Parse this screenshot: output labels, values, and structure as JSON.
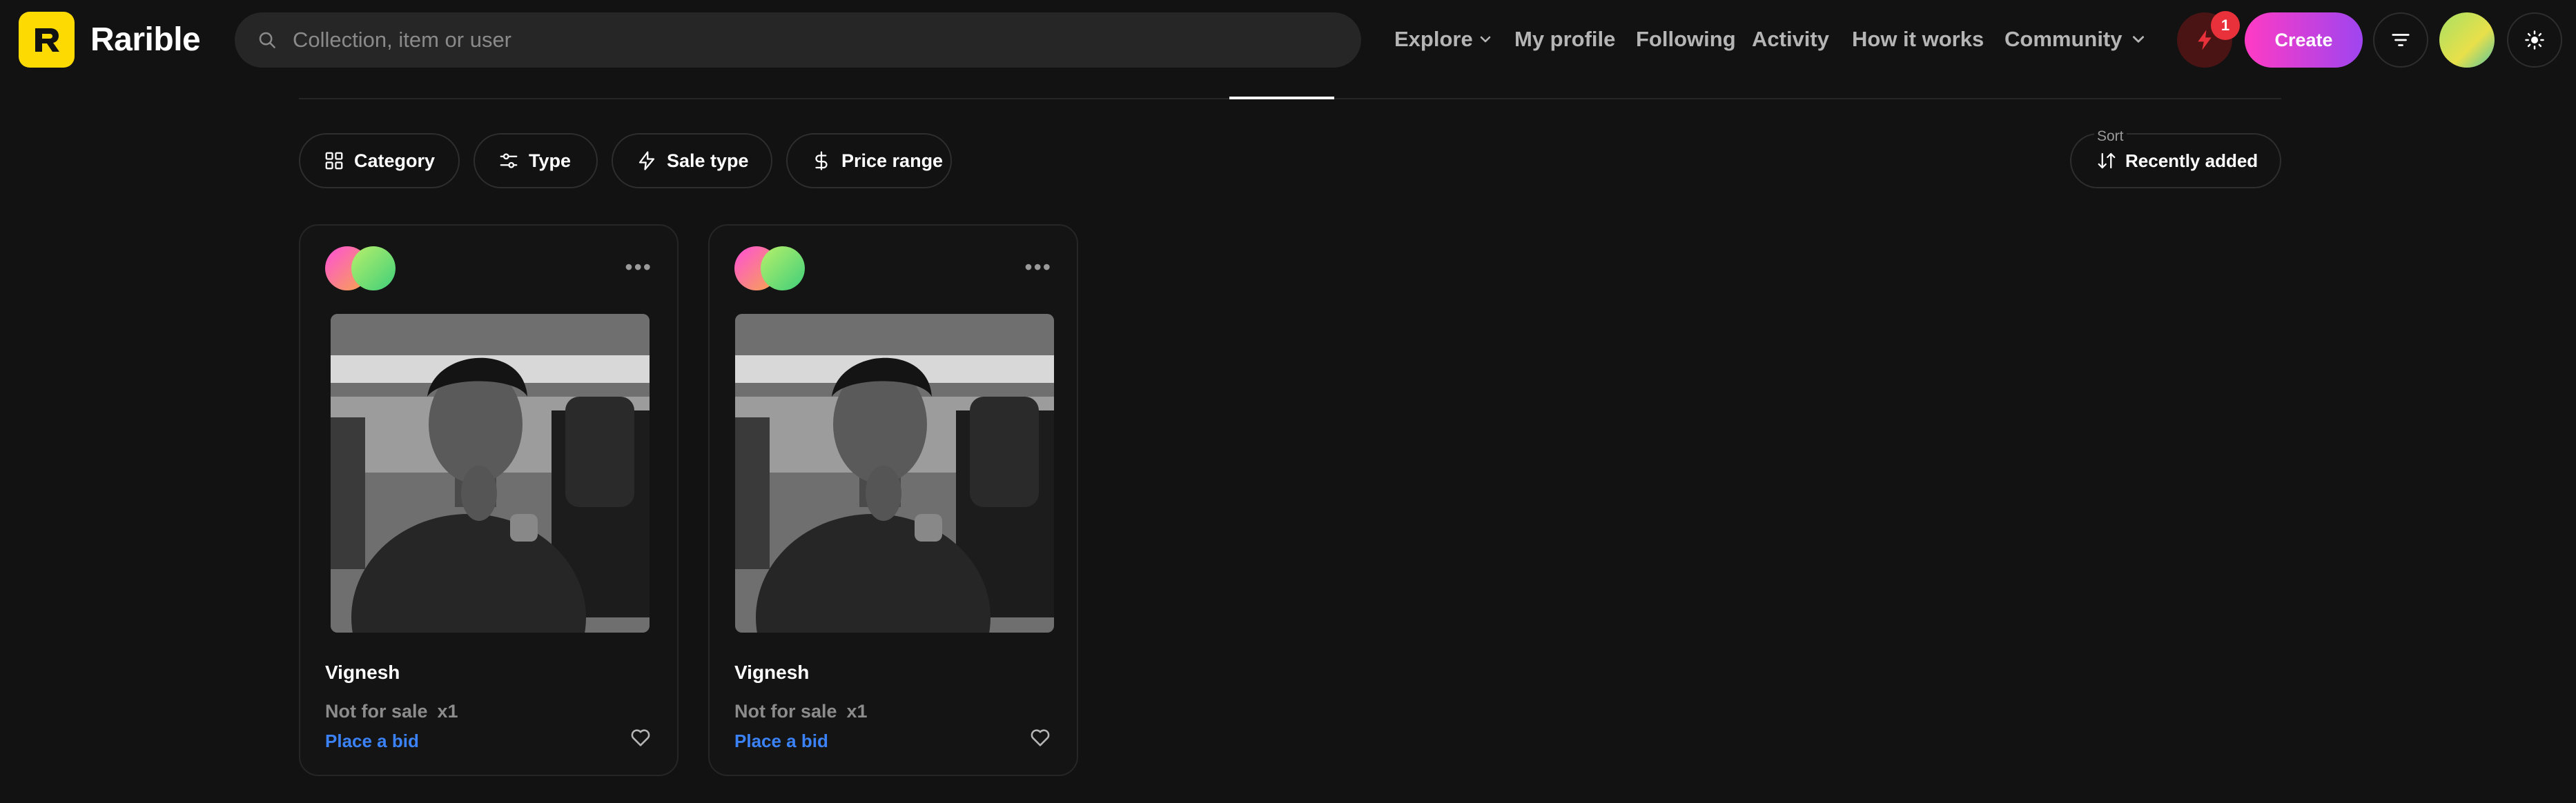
{
  "app": {
    "brand": "Rarible",
    "logo_letter": "R"
  },
  "search": {
    "placeholder": "Collection, item or user"
  },
  "nav": {
    "explore": "Explore",
    "my_profile": "My profile",
    "following": "Following",
    "activity": "Activity",
    "how_it_works": "How it works",
    "community": "Community"
  },
  "header_actions": {
    "notification_count": "1",
    "create_label": "Create"
  },
  "filters": {
    "category": "Category",
    "type": "Type",
    "sale_type": "Sale type",
    "price_range": "Price range",
    "sort_label": "Sort",
    "sort_value": "Recently added"
  },
  "cards": [
    {
      "title": "Vignesh",
      "status": "Not for sale",
      "quantity": "x1",
      "action": "Place a bid"
    },
    {
      "title": "Vignesh",
      "status": "Not for sale",
      "quantity": "x1",
      "action": "Place a bid"
    }
  ],
  "colors": {
    "background": "#121212",
    "logo_yellow": "#FEDA03",
    "create_gradient_start": "#ff3bc4",
    "create_gradient_end": "#9e45f0",
    "link_blue": "#3b82f6",
    "badge_red": "#e8313a"
  },
  "icons": [
    "search-icon",
    "chevron-down-icon",
    "bolt-icon",
    "filter-icon",
    "sun-icon",
    "grid-icon",
    "sliders-icon",
    "bolt-outline-icon",
    "dollar-icon",
    "sort-arrows-icon",
    "more-icon",
    "heart-icon"
  ]
}
